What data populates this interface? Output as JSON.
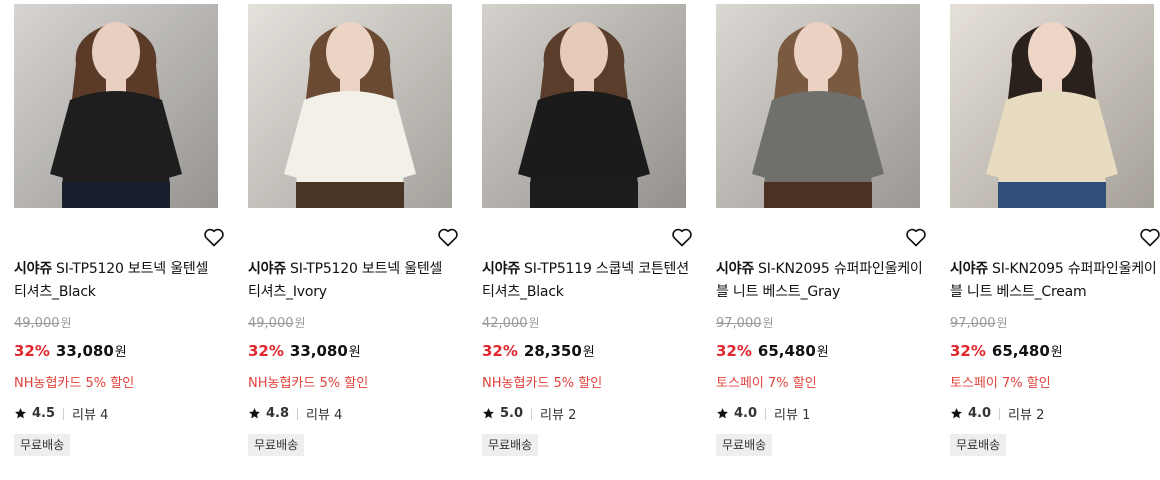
{
  "products": [
    {
      "brand": "시야쥬",
      "name": "SI-TP5120 보트넥 울텐셀 티셔츠_Black",
      "original_price": "49,000",
      "discount_rate": "32%",
      "sale_price": "33,080",
      "currency_unit": "원",
      "promo": "NH농협카드 5% 할인",
      "rating": "4.5",
      "reviews": "리뷰 4",
      "badge": "무료배송",
      "image": {
        "bg": "#c9c6c2",
        "garment": "#1e1e1e",
        "bottom": "#1a1f2e",
        "hair": "#5b3a28",
        "skin": "#e9cfbf"
      }
    },
    {
      "brand": "시야쥬",
      "name": "SI-TP5120 보트넥 울텐셀 티셔츠_Ivory",
      "original_price": "49,000",
      "discount_rate": "32%",
      "sale_price": "33,080",
      "currency_unit": "원",
      "promo": "NH농협카드 5% 할인",
      "rating": "4.8",
      "reviews": "리뷰 4",
      "badge": "무료배송",
      "image": {
        "bg": "#dcd7d0",
        "garment": "#f3f0ea",
        "bottom": "#4a3525",
        "hair": "#6a4a33",
        "skin": "#ecd4c4"
      }
    },
    {
      "brand": "시야쥬",
      "name": "SI-TP5119 스쿱넥 코튼텐션 티셔츠_Black",
      "original_price": "42,000",
      "discount_rate": "32%",
      "sale_price": "28,350",
      "currency_unit": "원",
      "promo": "NH농협카드 5% 할인",
      "rating": "5.0",
      "reviews": "리뷰 2",
      "badge": "무료배송",
      "image": {
        "bg": "#c6c2bc",
        "garment": "#1b1b1b",
        "bottom": "#1c1c1c",
        "hair": "#5a3d2b",
        "skin": "#e6cbbb"
      }
    },
    {
      "brand": "시야쥬",
      "name": "SI-KN2095 슈퍼파인울케이블 니트 베스트_Gray",
      "original_price": "97,000",
      "discount_rate": "32%",
      "sale_price": "65,480",
      "currency_unit": "원",
      "promo": "토스페이 7% 할인",
      "rating": "4.0",
      "reviews": "리뷰 1",
      "badge": "무료배송",
      "image": {
        "bg": "#cfcac4",
        "garment": "#6f6f6c",
        "bottom": "#4a3121",
        "hair": "#7a5a40",
        "skin": "#ecd2c2"
      }
    },
    {
      "brand": "시야쥬",
      "name": "SI-KN2095 슈퍼파인울케이블 니트 베스트_Cream",
      "original_price": "97,000",
      "discount_rate": "32%",
      "sale_price": "65,480",
      "currency_unit": "원",
      "promo": "토스페이 7% 할인",
      "rating": "4.0",
      "reviews": "리뷰 2",
      "badge": "무료배송",
      "image": {
        "bg": "#ddd6cc",
        "garment": "#e8dcc0",
        "bottom": "#2f4f7a",
        "hair": "#2b211c",
        "skin": "#edd6c6"
      }
    }
  ]
}
